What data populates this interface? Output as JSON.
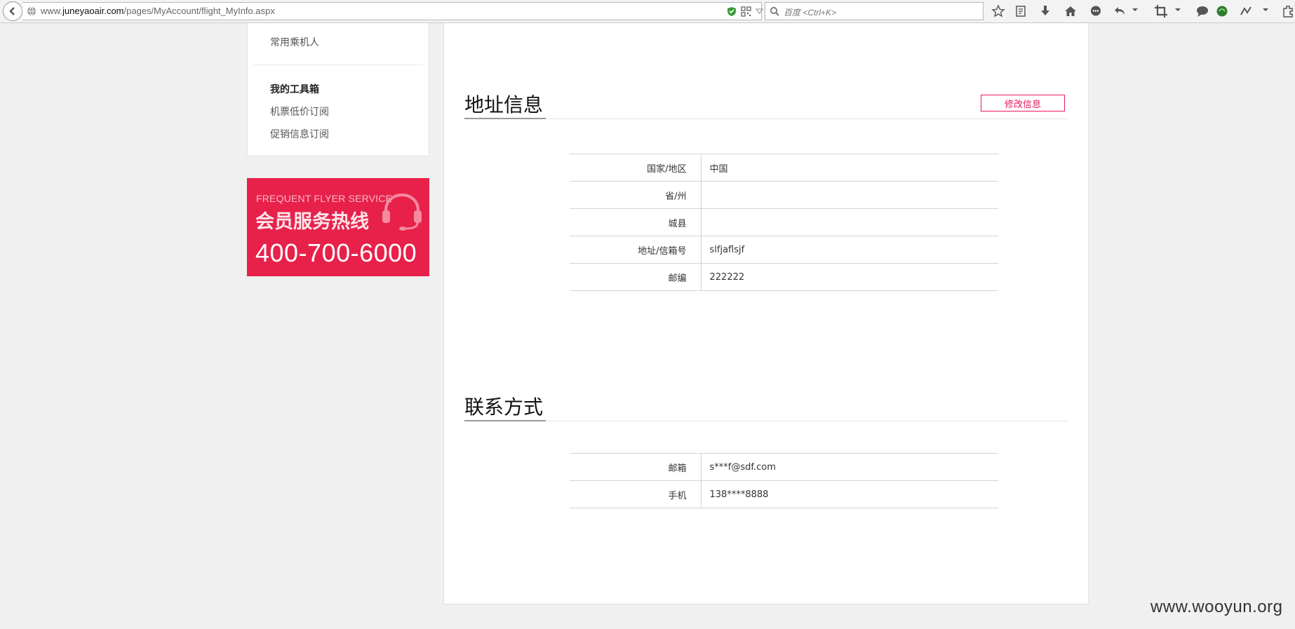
{
  "browser": {
    "url_prefix": "www.",
    "url_domain": "juneyaoair.com",
    "url_path": "/pages/MyAccount/flight_MyInfo.aspx",
    "search_placeholder": "百度 <Ctrl+K>"
  },
  "sidebar": {
    "frequent_passengers": "常用乘机人",
    "toolbox_heading": "我的工具箱",
    "toolbox_items": [
      "机票低价订阅",
      "促销信息订阅"
    ]
  },
  "hotline": {
    "english": "FREQUENT FLYER SERVICE",
    "chinese": "会员服务热线",
    "number": "400-700-6000"
  },
  "address_section": {
    "title": "地址信息",
    "edit_button": "修改信息",
    "rows": [
      {
        "label": "国家/地区",
        "value": "中国"
      },
      {
        "label": "省/州",
        "value": ""
      },
      {
        "label": "城县",
        "value": ""
      },
      {
        "label": "地址/信箱号",
        "value": "slfjaflsjf"
      },
      {
        "label": "邮编",
        "value": "222222"
      }
    ]
  },
  "contact_section": {
    "title": "联系方式",
    "rows": [
      {
        "label": "邮箱",
        "value": "s***f@sdf.com"
      },
      {
        "label": "手机",
        "value": "138****8888"
      }
    ]
  },
  "watermark": "www.wooyun.org",
  "colors": {
    "accent": "#e6185d",
    "hotline_bg": "#e8214a",
    "page_bg": "#eff0ef"
  }
}
